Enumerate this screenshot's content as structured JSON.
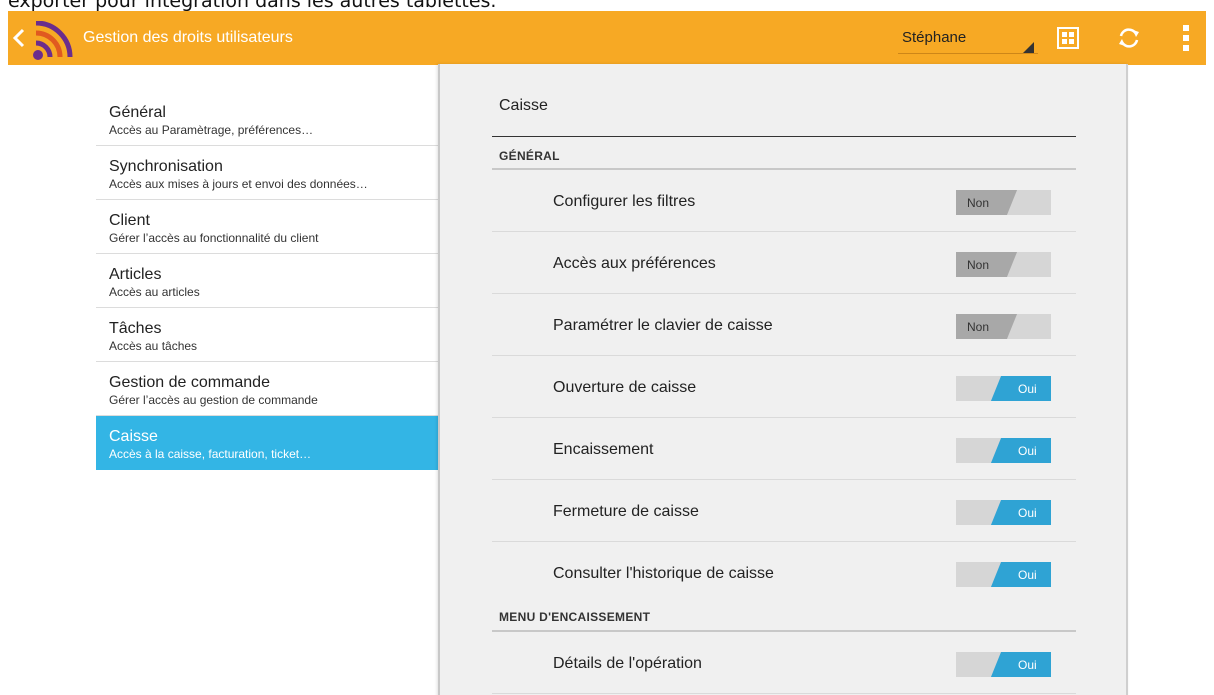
{
  "doc_text": "exporter pour intégration dans les autres tablettes.",
  "actionbar": {
    "title": "Gestion des droits utilisateurs",
    "user_select": "Stéphane",
    "colors": {
      "bar": "#f7a924",
      "accent": "#33b5e5"
    },
    "icons": [
      "back-arrow-icon",
      "app-logo-icon",
      "grid-icon",
      "refresh-icon",
      "overflow-menu-icon"
    ]
  },
  "sidebar": {
    "items": [
      {
        "title": "Général",
        "subtitle": "Accès au Paramètrage, préférences…"
      },
      {
        "title": "Synchronisation",
        "subtitle": "Accès aux mises à jours et envoi des données…"
      },
      {
        "title": "Client",
        "subtitle": "Gérer l’accès au fonctionnalité du client"
      },
      {
        "title": "Articles",
        "subtitle": "Accès au articles"
      },
      {
        "title": "Tâches",
        "subtitle": "Accès au tâches"
      },
      {
        "title": "Gestion de commande",
        "subtitle": "Gérer l’accès au gestion de commande"
      },
      {
        "title": "Caisse",
        "subtitle": "Accès à la caisse, facturation, ticket…",
        "selected": true
      }
    ]
  },
  "panel": {
    "title": "Caisse",
    "sections": [
      {
        "header": "GÉNÉRAL",
        "rows": [
          {
            "label": "Configurer les filtres",
            "state": "Non"
          },
          {
            "label": "Accès aux préférences",
            "state": "Non"
          },
          {
            "label": "Paramétrer le clavier de caisse",
            "state": "Non"
          },
          {
            "label": "Ouverture de caisse",
            "state": "Oui"
          },
          {
            "label": "Encaissement",
            "state": "Oui"
          },
          {
            "label": "Fermeture de caisse",
            "state": "Oui"
          },
          {
            "label": "Consulter l'historique de caisse",
            "state": "Oui"
          }
        ]
      },
      {
        "header": "MENU D'ENCAISSEMENT",
        "rows": [
          {
            "label": "Détails de l'opération",
            "state": "Oui"
          }
        ]
      }
    ]
  }
}
